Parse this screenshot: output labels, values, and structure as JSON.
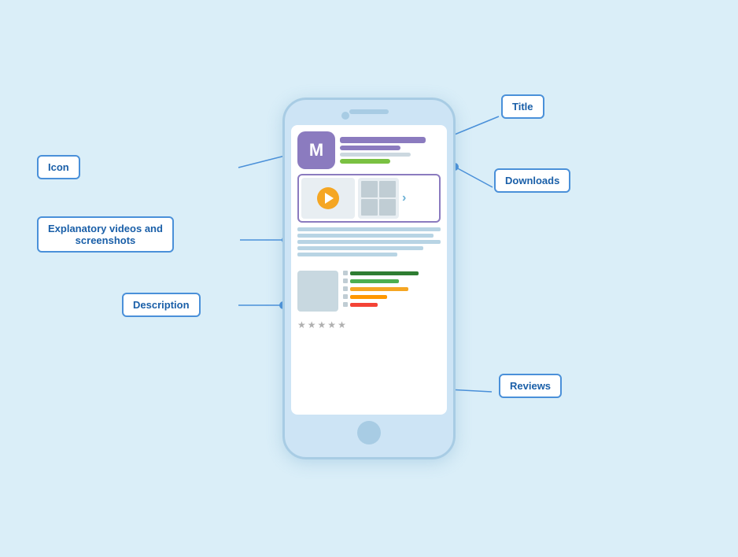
{
  "labels": {
    "title": "Title",
    "icon": "Icon",
    "downloads": "Downloads",
    "explanatory": "Explanatory videos and\nscreenshots",
    "description": "Description",
    "reviews": "Reviews"
  },
  "phone": {
    "app_letter": "M"
  },
  "colors": {
    "accent": "#4a90d9",
    "phone_bg": "#cde4f5",
    "page_bg": "#daeef8",
    "label_border": "#4a90d9",
    "label_text": "#1a5fa8"
  }
}
